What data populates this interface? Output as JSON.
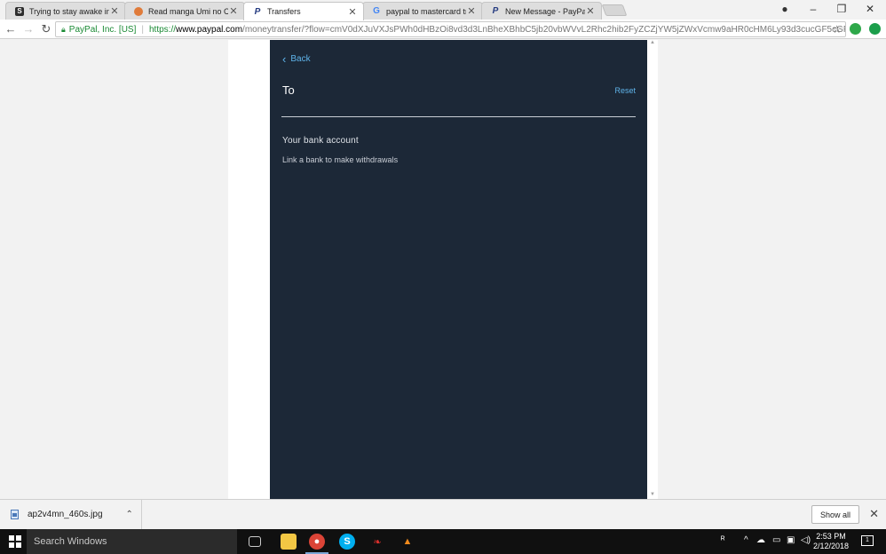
{
  "browser": {
    "tabs": [
      {
        "title": "Trying to stay awake in c",
        "favicon": "stackexchange-icon",
        "color": "#2e2e2e",
        "active": false
      },
      {
        "title": "Read manga Umi no Cra",
        "favicon": "manga-icon",
        "color": "#e07b3a",
        "active": false
      },
      {
        "title": "Transfers",
        "favicon": "paypal-icon",
        "color": "#253b80",
        "active": true
      },
      {
        "title": "paypal to mastercard tra",
        "favicon": "google-icon",
        "color": "#4285f4",
        "active": false
      },
      {
        "title": "New Message - PayPal C",
        "favicon": "paypal-icon",
        "color": "#253b80",
        "active": false
      }
    ],
    "address": {
      "ev_name": "PayPal, Inc. [US]",
      "scheme": "https://",
      "host": "www.paypal.com",
      "path": "/moneytransfer/?flow=cmV0dXJuVXJsPWh0dHBzOi8vd3d3LnBheXBhbC5jb20vbWVvL2Rhc2hib2FyZCZjYW5jZWxVcmw9aHR0cHM6Ly93d3cucGF5cGFsLm..."
    }
  },
  "page": {
    "back_label": "Back",
    "to_label": "To",
    "reset_label": "Reset",
    "bank_title": "Your bank account",
    "bank_subtitle": "Link a bank to make withdrawals"
  },
  "downloads": {
    "file_name": "ap2v4mn_460s.jpg",
    "show_all_label": "Show all"
  },
  "taskbar": {
    "search_placeholder": "Search Windows",
    "time": "2:53 PM",
    "date": "2/12/2018",
    "notification_count": "1"
  },
  "colors": {
    "panel_bg": "#1c2837",
    "link_blue": "#5fb4ea"
  }
}
